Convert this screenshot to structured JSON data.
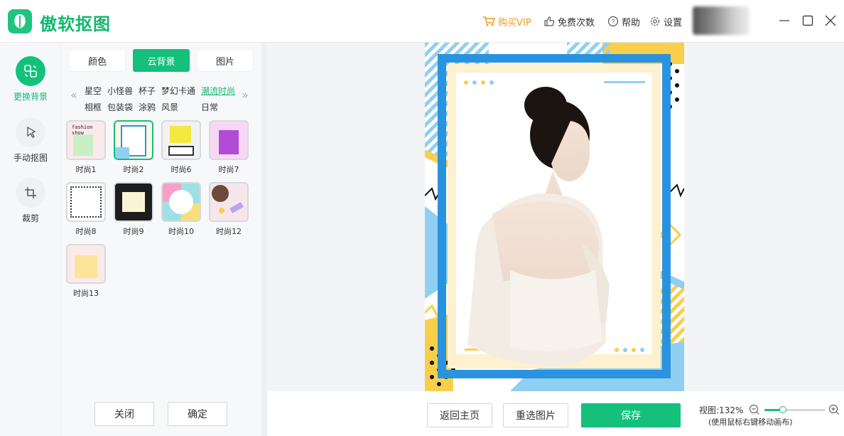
{
  "app": {
    "title": "傲软抠图"
  },
  "topbar": {
    "vip": "购买VIP",
    "free_count": "免费次数",
    "help": "帮助",
    "settings": "设置"
  },
  "nav": [
    {
      "label": "更换背景",
      "icon": "swap-image-icon",
      "active": true
    },
    {
      "label": "手动抠图",
      "icon": "lasso-icon",
      "active": false
    },
    {
      "label": "裁剪",
      "icon": "crop-icon",
      "active": false
    }
  ],
  "panel": {
    "tabs": [
      "颜色",
      "云背景",
      "图片"
    ],
    "active_tab": "云背景",
    "categories_row1": [
      "星空",
      "小怪兽",
      "杯子",
      "梦幻卡通",
      "潮流时尚"
    ],
    "categories_row2": [
      "相框",
      "包装袋",
      "涂鸦",
      "风景",
      "日常"
    ],
    "active_category": "潮流时尚",
    "thumbnails": [
      {
        "label": "时尚1",
        "text": "fashion show"
      },
      {
        "label": "时尚2",
        "selected": true
      },
      {
        "label": "时尚6"
      },
      {
        "label": "时尚7"
      },
      {
        "label": "时尚8"
      },
      {
        "label": "时尚9"
      },
      {
        "label": "时尚10"
      },
      {
        "label": "时尚12"
      },
      {
        "label": "时尚13"
      }
    ],
    "close_label": "关闭",
    "confirm_label": "确定"
  },
  "actions": {
    "home_label": "返回主页",
    "reselect_label": "重选图片",
    "save_label": "保存"
  },
  "zoom": {
    "label": "视图:132%",
    "hint": "(使用鼠标右键移动画布)",
    "level_fraction": 0.3
  },
  "colors": {
    "brand": "#14c07c",
    "vip": "#f09a1a",
    "poster_blue": "#2a93e0",
    "poster_yellow": "#f7cf4a"
  }
}
